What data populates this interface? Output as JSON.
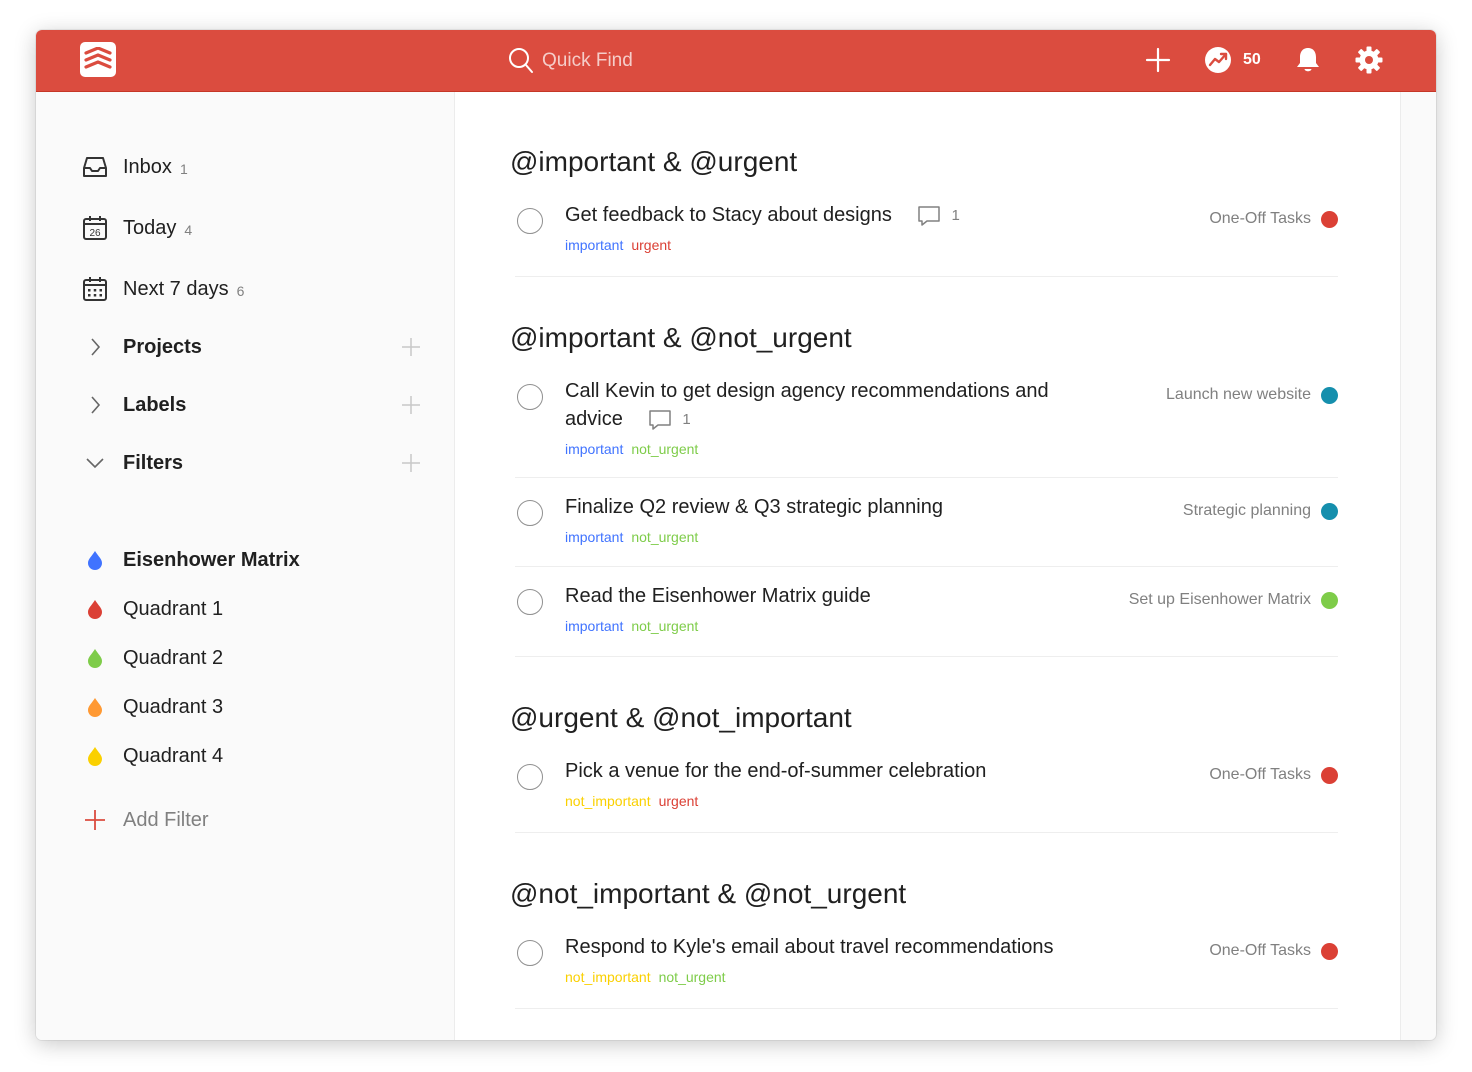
{
  "topbar": {
    "search_placeholder": "Quick Find",
    "karma_count": "50",
    "icons": [
      "todoist-logo-icon",
      "search-icon",
      "add-task-icon",
      "karma-icon",
      "bell-icon",
      "gear-icon"
    ]
  },
  "sidebar": {
    "nav": [
      {
        "label": "Inbox",
        "count": "1",
        "icon": "inbox-icon"
      },
      {
        "label": "Today",
        "count": "4",
        "icon": "calendar-today-icon",
        "icon_text": "26"
      },
      {
        "label": "Next 7 days",
        "count": "6",
        "icon": "calendar-week-icon"
      }
    ],
    "sections": [
      {
        "label": "Projects",
        "expanded": false
      },
      {
        "label": "Labels",
        "expanded": false
      },
      {
        "label": "Filters",
        "expanded": true
      }
    ],
    "filters": [
      {
        "label": "Eisenhower Matrix",
        "color": "#4073ff"
      },
      {
        "label": "Quadrant 1",
        "color": "#db4035"
      },
      {
        "label": "Quadrant 2",
        "color": "#7ecc49"
      },
      {
        "label": "Quadrant 3",
        "color": "#ff9933"
      },
      {
        "label": "Quadrant 4",
        "color": "#fad000"
      }
    ],
    "add_filter": "Add Filter"
  },
  "label_colors": {
    "important": "#4073ff",
    "urgent": "#db4035",
    "not_urgent": "#7ecc49",
    "not_important": "#fad000"
  },
  "groups": [
    {
      "title": "@important & @urgent",
      "tasks": [
        {
          "content": "Get feedback to Stacy about designs",
          "comments": "1",
          "labels": [
            "important",
            "urgent"
          ],
          "project": "One-Off Tasks",
          "project_color": "#db4035"
        }
      ]
    },
    {
      "title": "@important & @not_urgent",
      "tasks": [
        {
          "content": "Call Kevin to get design agency recommendations and advice",
          "comments": "1",
          "labels": [
            "important",
            "not_urgent"
          ],
          "project": "Launch new website",
          "project_color": "#158fad"
        },
        {
          "content": "Finalize Q2 review & Q3 strategic planning",
          "labels": [
            "important",
            "not_urgent"
          ],
          "project": "Strategic planning",
          "project_color": "#158fad"
        },
        {
          "content": "Read the Eisenhower Matrix guide",
          "labels": [
            "important",
            "not_urgent"
          ],
          "project": "Set up Eisenhower Matrix",
          "project_color": "#7ecc49"
        }
      ]
    },
    {
      "title": "@urgent & @not_important",
      "tasks": [
        {
          "content": "Pick a venue for the end-of-summer celebration",
          "labels": [
            "not_important",
            "urgent"
          ],
          "project": "One-Off Tasks",
          "project_color": "#db4035"
        }
      ]
    },
    {
      "title": "@not_important & @not_urgent",
      "tasks": [
        {
          "content": "Respond to Kyle's email about travel recommendations",
          "labels": [
            "not_important",
            "not_urgent"
          ],
          "project": "One-Off Tasks",
          "project_color": "#db4035"
        }
      ]
    }
  ]
}
